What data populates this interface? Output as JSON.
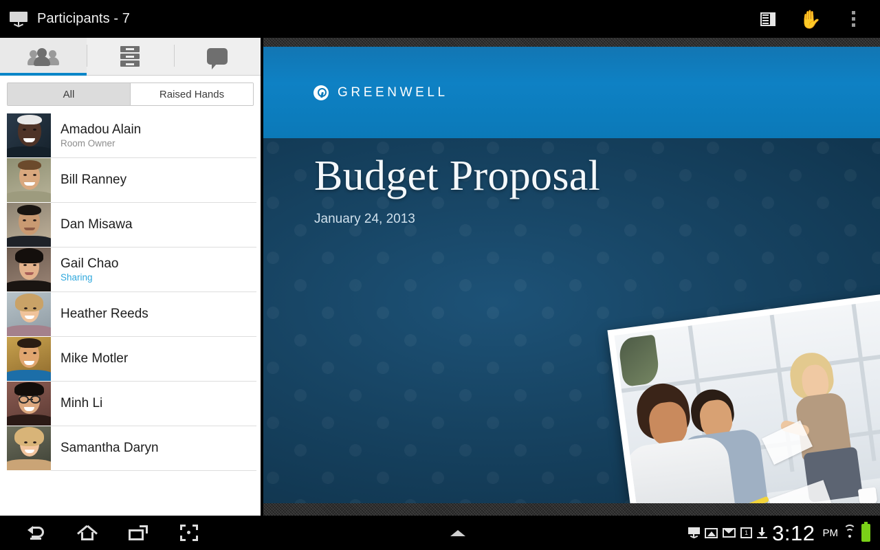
{
  "titlebar": {
    "icon": "projector-icon",
    "title": "Participants - 7",
    "actions": [
      {
        "name": "layout-icon",
        "label": "Layout"
      },
      {
        "name": "raise-hand-icon",
        "label": "✋"
      },
      {
        "name": "overflow-menu-icon",
        "label": "More options"
      }
    ]
  },
  "panel": {
    "tabs": [
      {
        "name": "tab-participants",
        "icon": "people-icon",
        "active": true
      },
      {
        "name": "tab-materials",
        "icon": "cabinet-icon",
        "active": false
      },
      {
        "name": "tab-chat",
        "icon": "chat-icon",
        "active": false
      }
    ],
    "filter": {
      "all_label": "All",
      "raised_hands_label": "Raised Hands",
      "selected": "All"
    },
    "participants": [
      {
        "name": "Amadou Alain",
        "status": "Room Owner",
        "status_kind": "owner"
      },
      {
        "name": "Bill Ranney",
        "status": "",
        "status_kind": "none"
      },
      {
        "name": "Dan Misawa",
        "status": "",
        "status_kind": "none"
      },
      {
        "name": "Gail Chao",
        "status": "Sharing",
        "status_kind": "sharing"
      },
      {
        "name": "Heather Reeds",
        "status": "",
        "status_kind": "none"
      },
      {
        "name": "Mike Motler",
        "status": "",
        "status_kind": "none"
      },
      {
        "name": "Minh Li",
        "status": "",
        "status_kind": "none"
      },
      {
        "name": "Samantha Daryn",
        "status": "",
        "status_kind": "none"
      }
    ]
  },
  "slide": {
    "brand": "GREENWELL",
    "title": "Budget Proposal",
    "date": "January 24, 2013",
    "banner_color": "#0b79b8",
    "body_color": "#174463"
  },
  "navbar": {
    "buttons": [
      {
        "name": "back-button",
        "icon": "back-icon"
      },
      {
        "name": "home-button",
        "icon": "home-icon"
      },
      {
        "name": "recents-button",
        "icon": "recent-icon"
      },
      {
        "name": "screenshot-button",
        "icon": "screenshot-icon"
      }
    ],
    "expand_icon": "chevron-up-icon",
    "status": {
      "icons": [
        "projector-icon",
        "image-icon",
        "email-icon",
        "calendar-icon",
        "download-icon"
      ],
      "calendar_day": "1",
      "time": "3:12",
      "ampm": "PM",
      "wifi": "wifi-icon",
      "battery": "battery-icon"
    }
  }
}
